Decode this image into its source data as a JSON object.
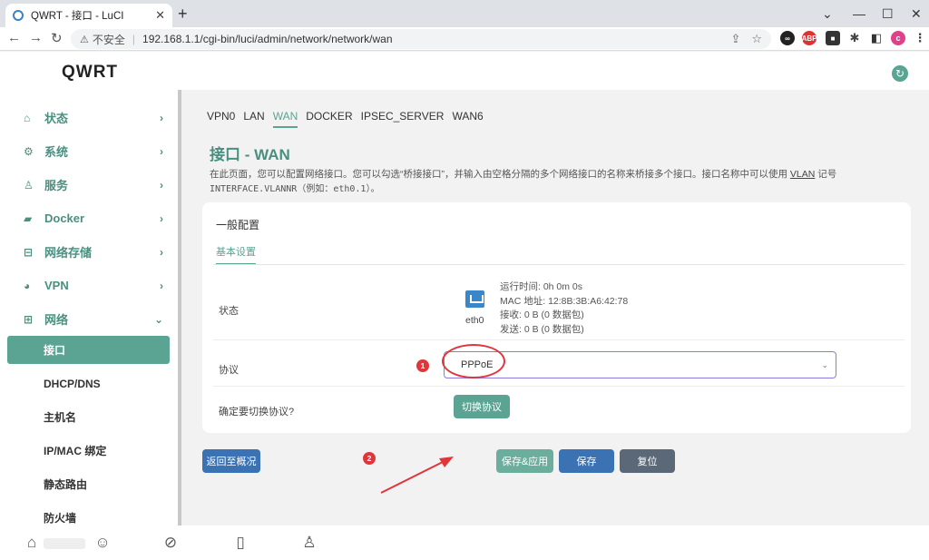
{
  "browser": {
    "tab_title": "QWRT - 接口 - LuCI",
    "tab_close": "✕",
    "new_tab": "+",
    "insecure_label": "不安全",
    "url": "192.168.1.1/cgi-bin/luci/admin/network/network/wan",
    "ext_abp": "ABP",
    "ext_profile": "c"
  },
  "header": {
    "brand": "QWRT"
  },
  "sidebar": {
    "items": [
      {
        "label": "状态",
        "icon": "home-icon"
      },
      {
        "label": "系统",
        "icon": "gear-icon"
      },
      {
        "label": "服务",
        "icon": "user-icon"
      },
      {
        "label": "Docker",
        "icon": "docker-icon"
      },
      {
        "label": "网络存储",
        "icon": "storage-icon"
      },
      {
        "label": "VPN",
        "icon": "vpn-icon"
      },
      {
        "label": "网络",
        "icon": "network-icon"
      }
    ],
    "sub_items": [
      {
        "label": "接口"
      },
      {
        "label": "DHCP/DNS"
      },
      {
        "label": "主机名"
      },
      {
        "label": "IP/MAC 绑定"
      },
      {
        "label": "静态路由"
      },
      {
        "label": "防火墙"
      }
    ]
  },
  "main": {
    "tabs": [
      "VPN0",
      "LAN",
      "WAN",
      "DOCKER",
      "IPSEC_SERVER",
      "WAN6"
    ],
    "title": "接口 - WAN",
    "desc_1": "在此页面，您可以配置网络接口。您可以勾选“桥接接口”，并输入由空格分隔的多个网络接口的名称来桥接多个接口。接口名称中可以使用 ",
    "desc_vlan": "VLAN",
    "desc_2": " 记号",
    "desc_3": "INTERFACE.VLANNR（例如：eth0.1）。",
    "card_title": "一般配置",
    "subtab": "基本设置",
    "status_label": "状态",
    "eth_name": "eth0",
    "status_lines": [
      "运行时间: 0h 0m 0s",
      "MAC 地址: 12:8B:3B:A6:42:78",
      "接收: 0 B (0 数据包)",
      "发送: 0 B (0 数据包)"
    ],
    "protocol_label": "协议",
    "protocol_value": "PPPoE",
    "switch_label": "确定要切换协议?",
    "switch_button": "切换协议",
    "badge_1": "1",
    "badge_2": "2",
    "back_button": "返回至概况",
    "save_apply_button": "保存&应用",
    "save_button": "保存",
    "reset_button": "复位"
  },
  "colors": {
    "accent": "#5ba493",
    "primary": "#3a72b4",
    "reset": "#5b6878",
    "annotation": "#e0353b"
  }
}
